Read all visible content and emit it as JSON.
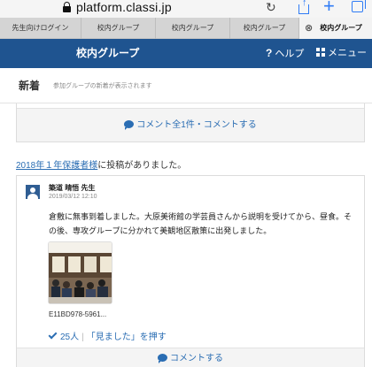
{
  "browser": {
    "url": "platform.classi.jp",
    "tabs": [
      {
        "label": "先生向けログイン"
      },
      {
        "label": "校内グループ"
      },
      {
        "label": "校内グループ"
      },
      {
        "label": "校内グループ"
      },
      {
        "label": "校内グループ",
        "active": true
      }
    ],
    "accent_color": "#2f7bf5"
  },
  "header": {
    "title": "校内グループ",
    "help_label": "ヘルプ",
    "menu_label": "メニュー",
    "color": "#1f5490"
  },
  "subheader": {
    "title": "新着",
    "note": "参加グループの新着が表示されます"
  },
  "feed": {
    "prev_card": {
      "comment_label": "コメント全1件・コメントする"
    },
    "post_intro": {
      "group_link": "2018年１年保護者様",
      "suffix": "に投稿がありました。"
    },
    "post": {
      "author": "築道 晴悟 先生",
      "date": "2019/03/12 12:10",
      "body": "倉敷に無事到着しました。大原美術館の学芸員さんから説明を受けてから、昼食。その後、専攻グループに分かれて美観地区散策に出発しました。",
      "attachment_name": "E11BD978-5961...",
      "seen_count": "25人",
      "seen_button": "「見ました」を押す",
      "comment_label": "コメントする"
    }
  }
}
